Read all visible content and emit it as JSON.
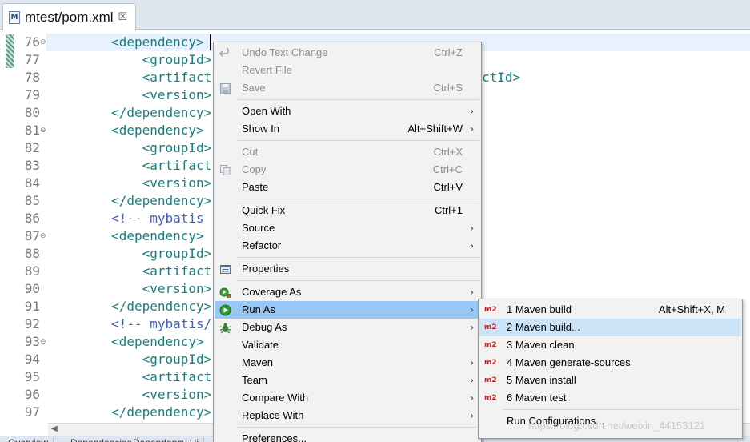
{
  "tab": {
    "icon": "maven-pom-file-icon",
    "icon_glyph": "M",
    "title": "mtest/pom.xml",
    "close_glyph": "☒"
  },
  "editor": {
    "lines": [
      {
        "num": "76",
        "fold": "⊖",
        "text": "        <dependency>",
        "kind": "tag"
      },
      {
        "num": "77",
        "fold": "",
        "text": "            <groupId>",
        "kind": "tag"
      },
      {
        "num": "78",
        "fold": "",
        "text": "            <artifactId>",
        "kind": "tag",
        "tail": "ctId>"
      },
      {
        "num": "79",
        "fold": "",
        "text": "            <version>",
        "kind": "tag"
      },
      {
        "num": "80",
        "fold": "",
        "text": "        </dependency>",
        "kind": "tag"
      },
      {
        "num": "81",
        "fold": "⊖",
        "text": "        <dependency>",
        "kind": "tag"
      },
      {
        "num": "82",
        "fold": "",
        "text": "            <groupId>",
        "kind": "tag"
      },
      {
        "num": "83",
        "fold": "",
        "text": "            <artifact",
        "kind": "tag"
      },
      {
        "num": "84",
        "fold": "",
        "text": "            <version>",
        "kind": "tag"
      },
      {
        "num": "85",
        "fold": "",
        "text": "        </dependency>",
        "kind": "tag"
      },
      {
        "num": "86",
        "fold": "",
        "text": "        <!-- mybatis",
        "kind": "comment"
      },
      {
        "num": "87",
        "fold": "⊖",
        "text": "        <dependency>",
        "kind": "tag"
      },
      {
        "num": "88",
        "fold": "",
        "text": "            <groupId>",
        "kind": "tag"
      },
      {
        "num": "89",
        "fold": "",
        "text": "            <artifact",
        "kind": "tag"
      },
      {
        "num": "90",
        "fold": "",
        "text": "            <version>",
        "kind": "tag"
      },
      {
        "num": "91",
        "fold": "",
        "text": "        </dependency>",
        "kind": "tag"
      },
      {
        "num": "92",
        "fold": "",
        "text": "        <!-- mybatis/",
        "kind": "comment"
      },
      {
        "num": "93",
        "fold": "⊖",
        "text": "        <dependency>",
        "kind": "tag"
      },
      {
        "num": "94",
        "fold": "",
        "text": "            <groupId>",
        "kind": "tag"
      },
      {
        "num": "95",
        "fold": "",
        "text": "            <artifact",
        "kind": "tag"
      },
      {
        "num": "96",
        "fold": "",
        "text": "            <version>",
        "kind": "tag"
      },
      {
        "num": "97",
        "fold": "",
        "text": "        </dependency>",
        "kind": "tag"
      }
    ],
    "hscroll_arrow": "◀"
  },
  "bottom_tabs": [
    "Overview",
    "Dependencies",
    "Dependency Hi"
  ],
  "context_menu": {
    "items": [
      {
        "type": "item",
        "label": "Undo Text Change",
        "accel": "Ctrl+Z",
        "disabled": true,
        "icon": "undo-icon"
      },
      {
        "type": "item",
        "label": "Revert File",
        "accel": "",
        "disabled": true
      },
      {
        "type": "item",
        "label": "Save",
        "accel": "Ctrl+S",
        "disabled": true,
        "icon": "save-icon"
      },
      {
        "type": "sep"
      },
      {
        "type": "item",
        "label": "Open With",
        "submenu": true
      },
      {
        "type": "item",
        "label": "Show In",
        "accel": "Alt+Shift+W",
        "submenu": true
      },
      {
        "type": "sep"
      },
      {
        "type": "item",
        "label": "Cut",
        "accel": "Ctrl+X",
        "disabled": true
      },
      {
        "type": "item",
        "label": "Copy",
        "accel": "Ctrl+C",
        "disabled": true,
        "icon": "copy-icon"
      },
      {
        "type": "item",
        "label": "Paste",
        "accel": "Ctrl+V"
      },
      {
        "type": "sep"
      },
      {
        "type": "item",
        "label": "Quick Fix",
        "accel": "Ctrl+1"
      },
      {
        "type": "item",
        "label": "Source",
        "submenu": true
      },
      {
        "type": "item",
        "label": "Refactor",
        "submenu": true
      },
      {
        "type": "sep"
      },
      {
        "type": "item",
        "label": "Properties",
        "icon": "properties-icon"
      },
      {
        "type": "sep"
      },
      {
        "type": "item",
        "label": "Coverage As",
        "submenu": true,
        "icon": "coverage-icon"
      },
      {
        "type": "item",
        "label": "Run As",
        "submenu": true,
        "highlighted": true,
        "icon": "run-icon"
      },
      {
        "type": "item",
        "label": "Debug As",
        "submenu": true,
        "icon": "debug-bug-icon"
      },
      {
        "type": "item",
        "label": "Validate"
      },
      {
        "type": "item",
        "label": "Maven",
        "submenu": true
      },
      {
        "type": "item",
        "label": "Team",
        "submenu": true
      },
      {
        "type": "item",
        "label": "Compare With",
        "submenu": true
      },
      {
        "type": "item",
        "label": "Replace With",
        "submenu": true
      },
      {
        "type": "sep"
      },
      {
        "type": "item",
        "label": "Preferences..."
      }
    ],
    "arrow_glyph": "›"
  },
  "run_as_submenu": {
    "items": [
      {
        "type": "item",
        "badge": "m2",
        "label": "1 Maven build",
        "accel": "Alt+Shift+X, M"
      },
      {
        "type": "item",
        "badge": "m2",
        "label": "2 Maven build...",
        "accel": "",
        "highlighted": true
      },
      {
        "type": "item",
        "badge": "m2",
        "label": "3 Maven clean",
        "accel": ""
      },
      {
        "type": "item",
        "badge": "m2",
        "label": "4 Maven generate-sources",
        "accel": ""
      },
      {
        "type": "item",
        "badge": "m2",
        "label": "5 Maven install",
        "accel": ""
      },
      {
        "type": "item",
        "badge": "m2",
        "label": "6 Maven test",
        "accel": ""
      },
      {
        "type": "sep"
      },
      {
        "type": "item",
        "badge": "",
        "label": "Run Configurations...",
        "accel": ""
      }
    ]
  },
  "watermark": "https://blog.csdn.net/weixin_44153121",
  "colors": {
    "highlight": "#99c8f4",
    "submenu_highlight": "#cce4f7",
    "tag": "#17807e",
    "comment": "#3f5fbf",
    "badge": "#c81e1e"
  }
}
